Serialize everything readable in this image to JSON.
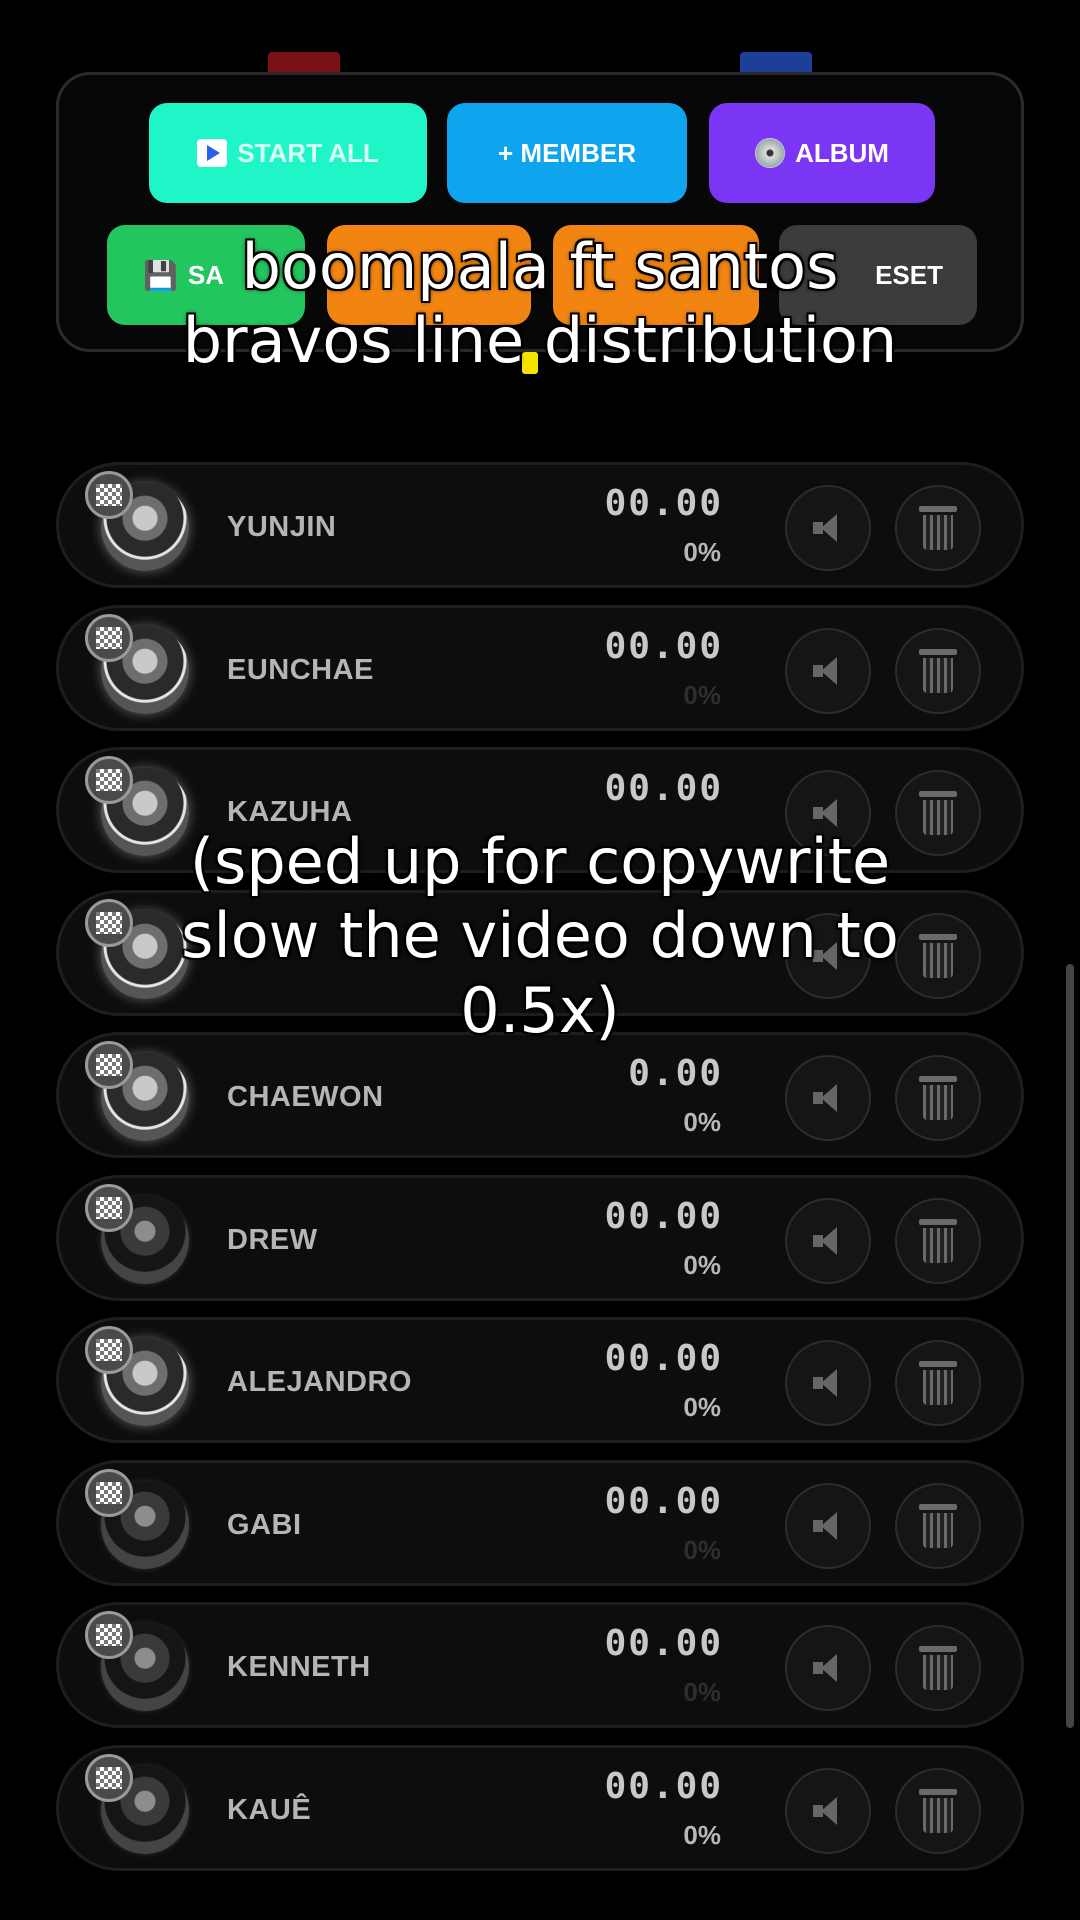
{
  "toolbar": {
    "start_all": "START ALL",
    "member": "+ MEMBER",
    "album": "ALBUM",
    "save_partial": "SA",
    "reset_partial": "ESET"
  },
  "overlay": {
    "title_line1": "boompala ft santos",
    "title_line2": "bravos line distribution",
    "note_line1": "(sped up for copywrite",
    "note_line2": "slow the video down to",
    "note_line3": "0.5x)"
  },
  "members": [
    {
      "name": "YUNJIN",
      "time": "00.00",
      "percent": "0%",
      "faint_percent": false
    },
    {
      "name": "EUNCHAE",
      "time": "00.00",
      "percent": "0%",
      "faint_percent": true
    },
    {
      "name": "KAZUHA",
      "time": "00.00",
      "percent": "",
      "faint_percent": true
    },
    {
      "name": "",
      "time": "",
      "percent": "",
      "faint_percent": true
    },
    {
      "name": "CHAEWON",
      "time": "0.00",
      "percent": "0%",
      "faint_percent": false
    },
    {
      "name": "DREW",
      "time": "00.00",
      "percent": "0%",
      "faint_percent": false
    },
    {
      "name": "ALEJANDRO",
      "time": "00.00",
      "percent": "0%",
      "faint_percent": false
    },
    {
      "name": "GABI",
      "time": "00.00",
      "percent": "0%",
      "faint_percent": true
    },
    {
      "name": "KENNETH",
      "time": "00.00",
      "percent": "0%",
      "faint_percent": true
    },
    {
      "name": "KAUÊ",
      "time": "00.00",
      "percent": "0%",
      "faint_percent": false
    }
  ],
  "icons": {
    "check": "checkered-icon",
    "sound": "speaker-icon",
    "delete": "trash-icon",
    "play": "play-icon",
    "save": "floppy-icon",
    "album": "disc-icon"
  },
  "colors": {
    "start_all": "#1ff5c6",
    "member": "#0ea5ee",
    "album": "#7b35f5",
    "save": "#22c55e",
    "orange": "#f28512",
    "reset": "#3c3c3c",
    "background": "#000000"
  }
}
